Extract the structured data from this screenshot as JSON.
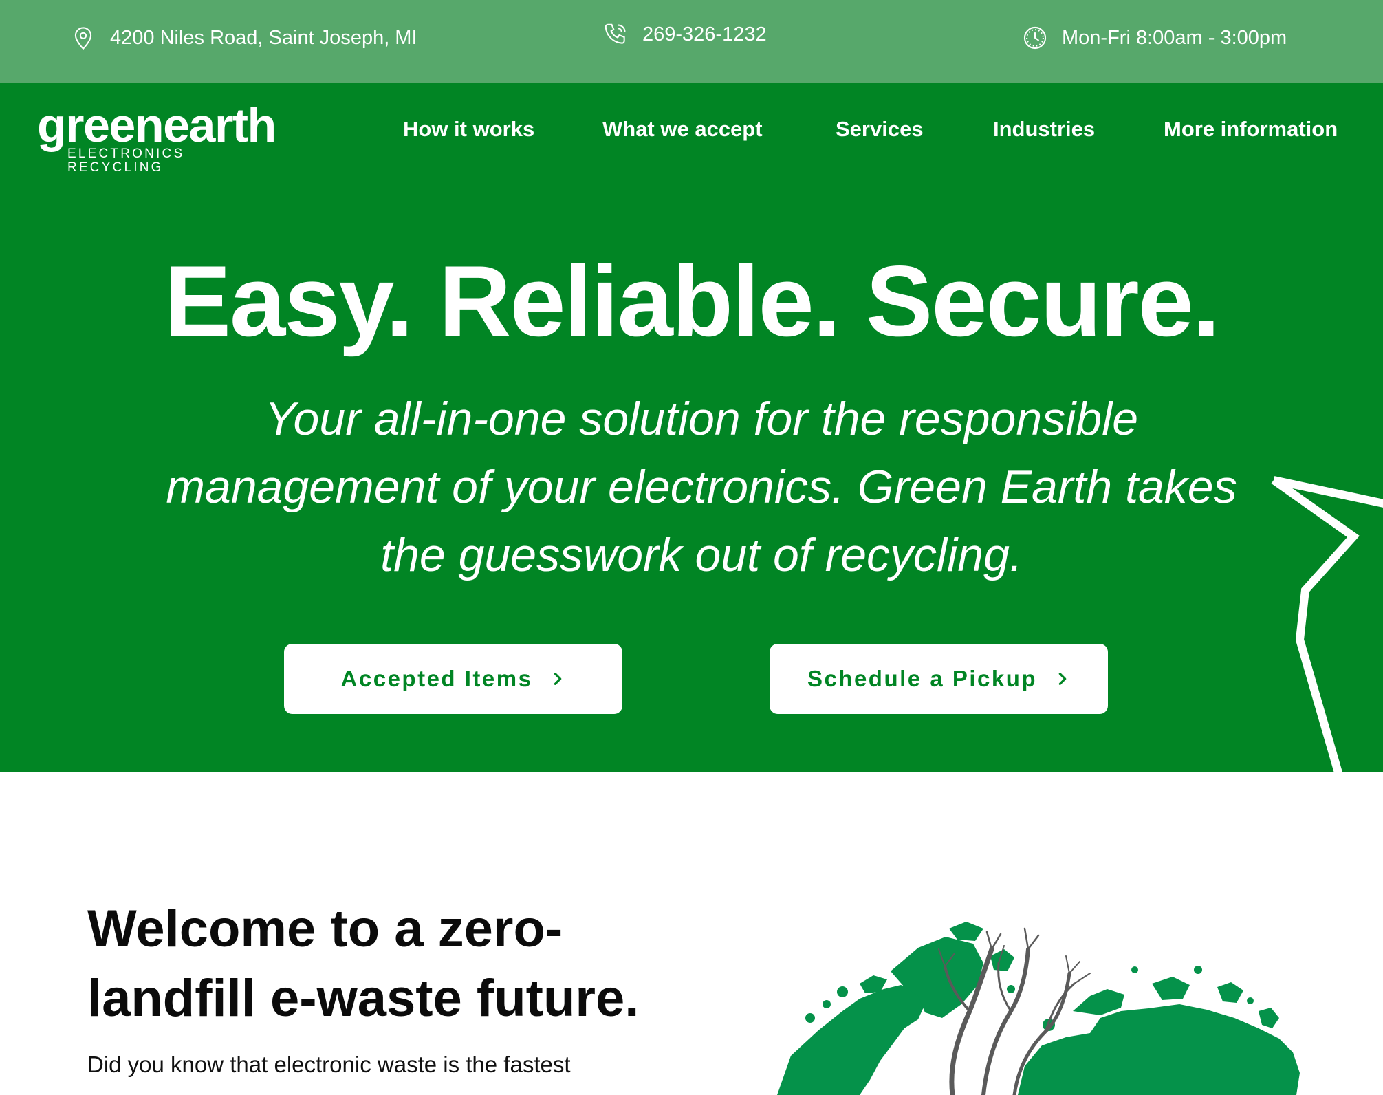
{
  "topbar": {
    "address": "4200 Niles Road, Saint Joseph, MI",
    "phone": "269-326-1232",
    "hours": "Mon-Fri 8:00am - 3:00pm",
    "icons": [
      "location-pin-icon",
      "phone-icon",
      "clock-icon"
    ]
  },
  "logo": {
    "main": "greenearth",
    "sub": "ELECTRONICS RECYCLING"
  },
  "nav": {
    "items": [
      "How it works",
      "What we accept",
      "Services",
      "Industries",
      "More information"
    ]
  },
  "hero": {
    "title": "Easy. Reliable. Secure.",
    "subtitle": "Your all-in-one solution for the responsible management of your electronics. Green Earth takes the guesswork out of recycling.",
    "buttons": [
      {
        "label": "Accepted Items",
        "icon": "chevron-right-icon"
      },
      {
        "label": "Schedule a Pickup",
        "icon": "chevron-right-icon"
      }
    ]
  },
  "welcome": {
    "title": "Welcome to a zero-landfill e-waste future.",
    "text": "Did you know that electronic waste is the fastest growing waste stream in the world? The world is"
  },
  "colors": {
    "topbar_bg": "#57a86b",
    "brand_green": "#018524",
    "globe_green": "#05924a",
    "text_dark": "#0b0b0b",
    "white": "#ffffff"
  }
}
